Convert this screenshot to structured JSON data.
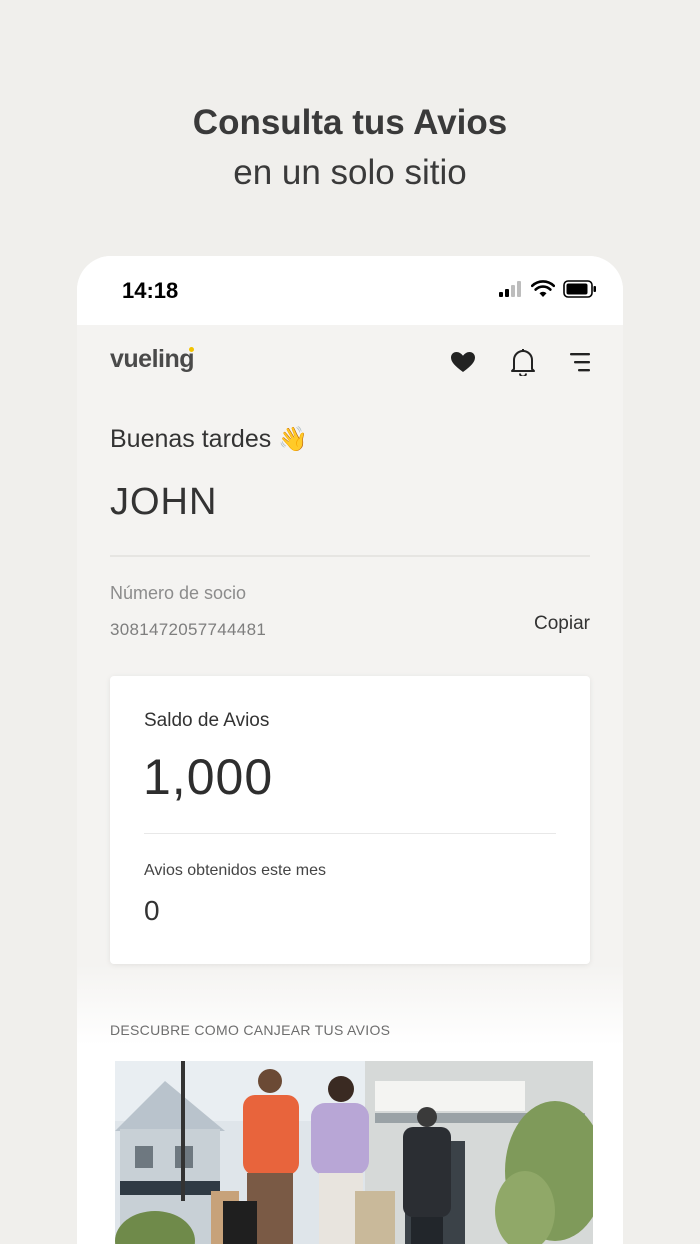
{
  "headline": {
    "line1": "Consulta tus Avios",
    "line2": "en un solo sitio"
  },
  "status_bar": {
    "time": "14:18"
  },
  "nav": {
    "logo": "vueling",
    "icons": [
      "heart-icon",
      "bell-icon",
      "menu-icon"
    ]
  },
  "greeting": {
    "text": "Buenas tardes",
    "emoji": "👋",
    "name": "JOHN"
  },
  "member": {
    "label": "Número de socio",
    "number": "3081472057744481",
    "copy_label": "Copiar"
  },
  "balance": {
    "label": "Saldo de Avios",
    "value": "1,000",
    "month_label": "Avios obtenidos este mes",
    "month_value": "0"
  },
  "discover": {
    "title": "DESCUBRE COMO CANJEAR TUS AVIOS"
  },
  "colors": {
    "background": "#f0efec",
    "logo_accent": "#f2c300",
    "text": "#333333"
  }
}
